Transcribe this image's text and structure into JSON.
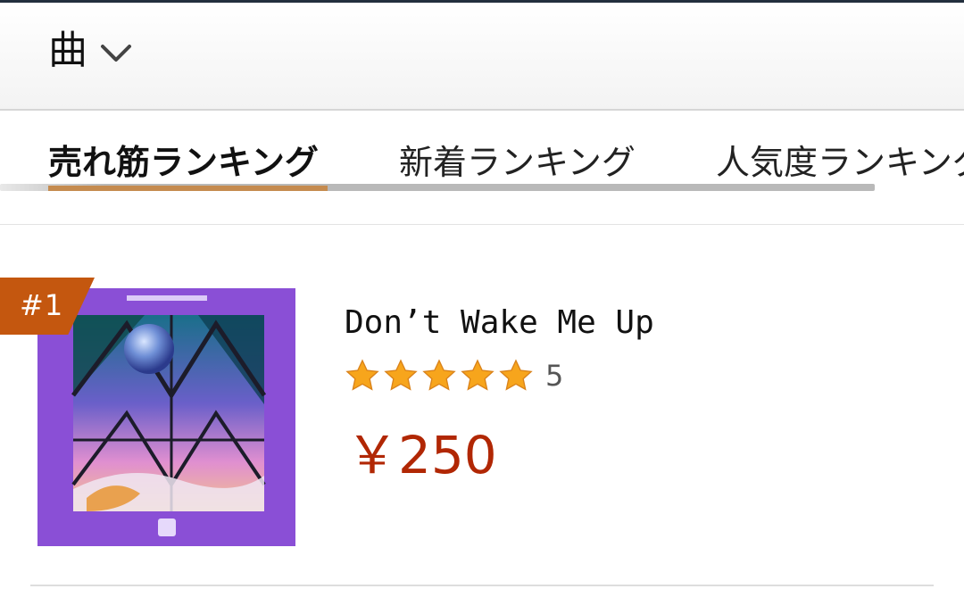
{
  "header": {
    "category_label": "曲"
  },
  "tabs": [
    {
      "label": "売れ筋ランキング",
      "active": true
    },
    {
      "label": "新着ランキング",
      "active": false
    },
    {
      "label": "人気度ランキング",
      "active": false
    }
  ],
  "product": {
    "rank": "#1",
    "title": "Don’t Wake Me Up",
    "rating_stars": 5,
    "rating_count": "5",
    "price": "￥250"
  },
  "colors": {
    "accent_indicator": "#c58b4f",
    "rank_badge": "#c4570f",
    "price": "#b12704",
    "star": "#f7a51c",
    "cover_frame": "#8a4fd6"
  },
  "icons": [
    "chevron-down-icon",
    "star-icon"
  ]
}
